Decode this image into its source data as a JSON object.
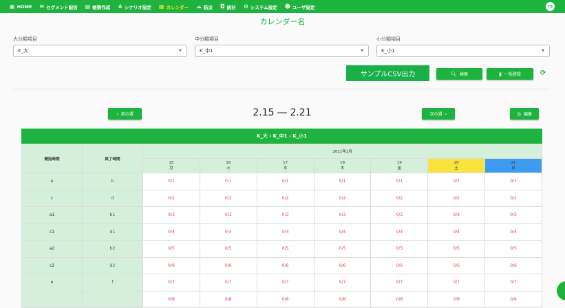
{
  "nav": {
    "items": [
      {
        "label": "HOME",
        "icon": "calendar-icon"
      },
      {
        "label": "セグメント配信",
        "icon": "megaphone-icon"
      },
      {
        "label": "帳票作成",
        "icon": "document-icon"
      },
      {
        "label": "シナリオ設定",
        "icon": "tree-icon"
      },
      {
        "label": "カレンダー",
        "icon": "calendar-icon"
      },
      {
        "label": "防災",
        "icon": "cloud-icon"
      },
      {
        "label": "統計",
        "icon": "box-icon"
      },
      {
        "label": "システム設定",
        "icon": "gear-icon"
      },
      {
        "label": "ユーザ設定",
        "icon": "users-icon"
      }
    ],
    "avatar": "TE"
  },
  "page_title": "カレンダー名",
  "filters": {
    "major": {
      "label": "大分類項目",
      "value": "K_大"
    },
    "middle": {
      "label": "中分類項目",
      "value": "K_中1"
    },
    "minor": {
      "label": "小分類項目",
      "value": "K_小1"
    }
  },
  "actions": {
    "csv_label": "サンプルCSV出力",
    "search_label": "検索",
    "bulk_label": "一括登録"
  },
  "week_nav": {
    "prev_label": "前の週",
    "next_label": "次の週",
    "range": "2.15 ― 2.21",
    "edit_label": "編集"
  },
  "calendar": {
    "breadcrumb": "K_大  ›  K_中1  ›  K_小1",
    "start_header": "開始時間",
    "end_header": "終了時間",
    "month": "2021年2月",
    "days": [
      {
        "num": "15",
        "dow": "月"
      },
      {
        "num": "16",
        "dow": "火"
      },
      {
        "num": "17",
        "dow": "水"
      },
      {
        "num": "18",
        "dow": "木"
      },
      {
        "num": "19",
        "dow": "金"
      },
      {
        "num": "20",
        "dow": "土"
      },
      {
        "num": "21",
        "dow": "日"
      }
    ],
    "rows": [
      {
        "start": "a",
        "end": "b",
        "count": "0",
        "cap": "1"
      },
      {
        "start": "c",
        "end": "d",
        "count": "0",
        "cap": "2"
      },
      {
        "start": "a1",
        "end": "b1",
        "count": "0",
        "cap": "3"
      },
      {
        "start": "c1",
        "end": "d1",
        "count": "0",
        "cap": "4"
      },
      {
        "start": "a2",
        "end": "b2",
        "count": "0",
        "cap": "5"
      },
      {
        "start": "c2",
        "end": "d2",
        "count": "0",
        "cap": "6"
      },
      {
        "start": "e",
        "end": "f",
        "count": "0",
        "cap": "7"
      },
      {
        "start": "",
        "end": "",
        "count": "0",
        "cap": "8"
      }
    ]
  }
}
